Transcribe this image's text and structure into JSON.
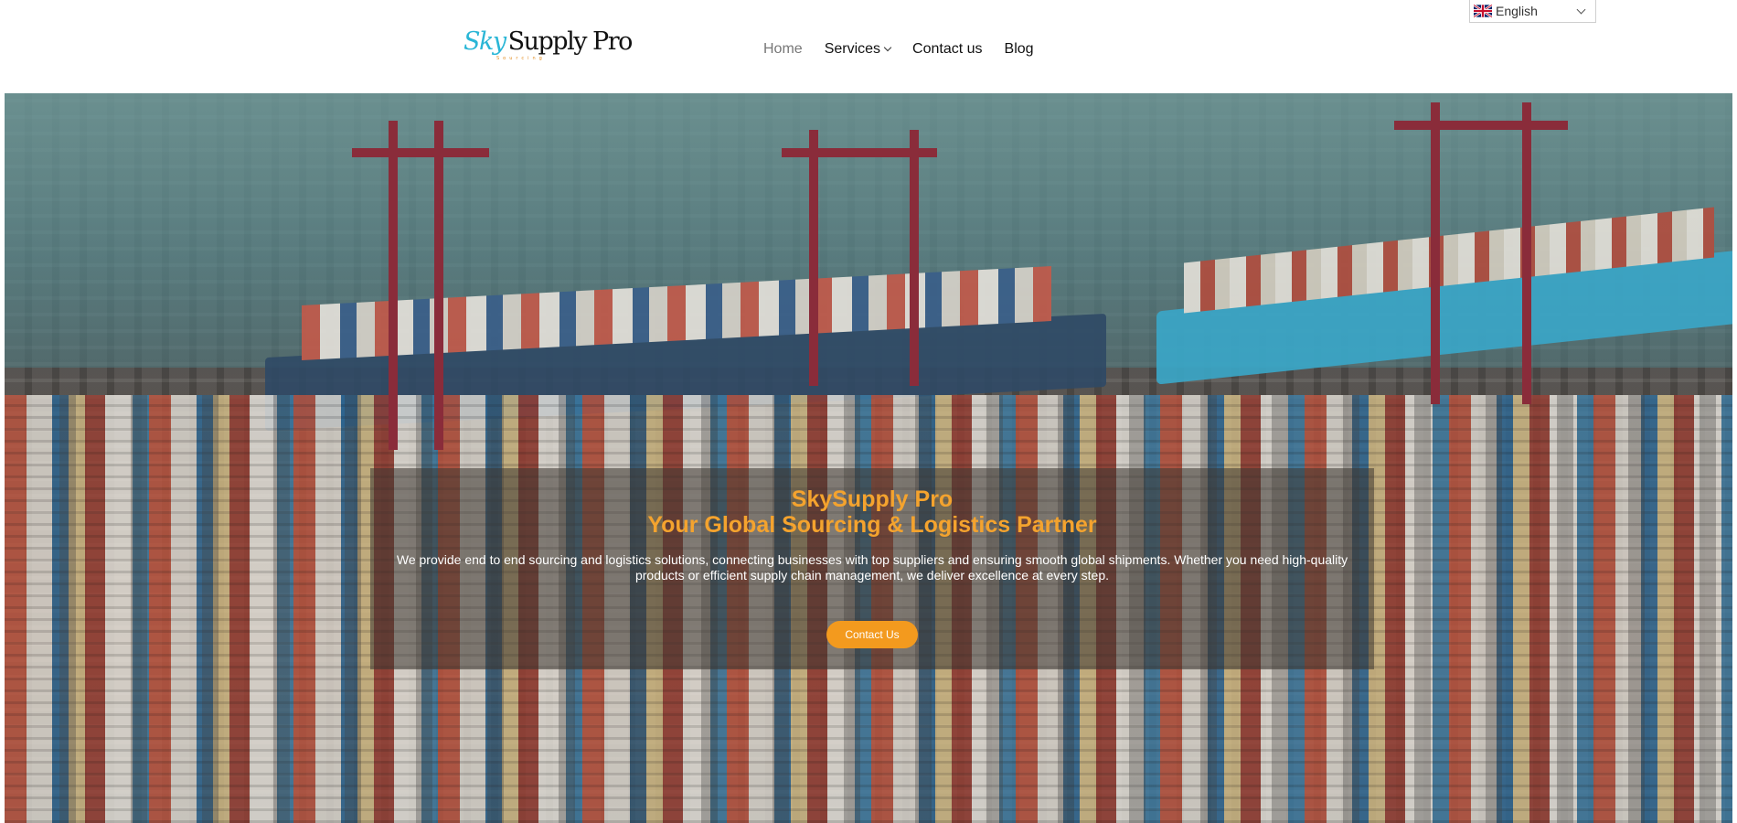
{
  "brand": {
    "logo_sky": "Sky",
    "logo_supply": "Supply Pro",
    "logo_tagline": "Sourcing"
  },
  "nav": {
    "items": [
      {
        "label": "Home",
        "active": true
      },
      {
        "label": "Services",
        "has_dropdown": true
      },
      {
        "label": "Contact us"
      },
      {
        "label": "Blog"
      }
    ]
  },
  "language": {
    "selected": "English",
    "flag_icon": "uk-flag-icon"
  },
  "hero": {
    "title_line1": "SkySupply Pro",
    "title_line2": "Your Global Sourcing & Logistics Partner",
    "description": "We provide end to end sourcing and logistics solutions, connecting businesses with top suppliers and ensuring smooth global shipments. Whether you need high-quality products or efficient supply chain management, we deliver excellence at every step.",
    "cta_label": "Contact Us"
  },
  "colors": {
    "accent": "#f39a1e",
    "title": "#f4a32e",
    "logo_sky": "#2ab6d6"
  }
}
